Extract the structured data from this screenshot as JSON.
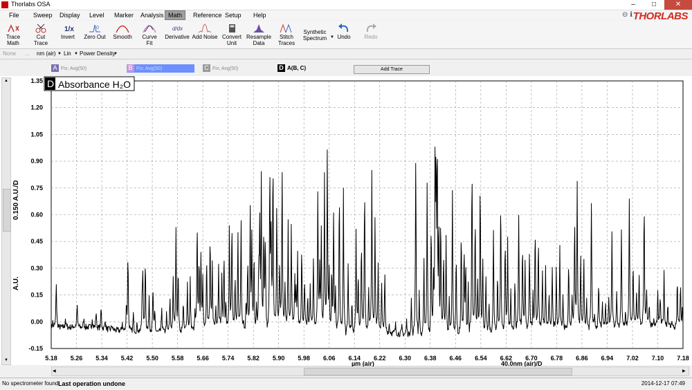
{
  "window": {
    "title": "Thorlabs OSA"
  },
  "menu": {
    "items": [
      "File",
      "Sweep",
      "Display",
      "Level",
      "Marker",
      "Analysis",
      "Math",
      "Reference",
      "Setup",
      "Help"
    ],
    "active": "Math"
  },
  "logo": "THORLABS",
  "toolbar": {
    "trace_math": "Trace Math",
    "cut_trace": "Cut Trace",
    "invert": "Invert",
    "zero_out": "Zero Out",
    "smooth": "Smooth",
    "curve_fit": "Curve Fit",
    "derivative": "Derivative",
    "add_noise": "Add Noise",
    "convert_unit": "Convert Unit",
    "resample_data": "Resample Data",
    "stitch_traces": "Stitch Traces",
    "synthetic_spectrum": "Synthetic Spectrum",
    "undo": "Undo",
    "redo": "Redo"
  },
  "unitbar": {
    "none": "None",
    "ellipsis": "...",
    "unit": "nm (air)",
    "scale": "Lin",
    "mode": "Power Density"
  },
  "traces": {
    "a": {
      "letter": "A",
      "label": "Fix; Avg(50)",
      "color": "#7b6fb4"
    },
    "b": {
      "letter": "B",
      "label": "Fix; Avg(50)",
      "color": "#c897d6"
    },
    "c": {
      "letter": "C",
      "label": "Fix; Avg(50)",
      "color": "#999999"
    },
    "d": {
      "letter": "D",
      "label": "A(B, C)",
      "color": "#000000"
    },
    "add_button": "Add Trace"
  },
  "plot": {
    "badge_letter": "D",
    "badge_title": "Absorbance H₂O",
    "y_axis_label": "A.U.",
    "y_scale_label": "0.150 A.U./D",
    "x_axis_label": "µm (air)",
    "x_scale_label": "40.0nm (air)/D"
  },
  "chart_data": {
    "type": "line",
    "title": "Absorbance H₂O",
    "xlabel": "µm (air)",
    "ylabel": "A.U.",
    "xlim": [
      5.18,
      7.18
    ],
    "ylim": [
      -0.15,
      1.35
    ],
    "x_ticks": [
      "5.18",
      "5.26",
      "5.34",
      "5.42",
      "5.50",
      "5.58",
      "5.66",
      "5.74",
      "5.82",
      "5.90",
      "5.98",
      "6.06",
      "6.14",
      "6.22",
      "6.30",
      "6.38",
      "6.46",
      "6.54",
      "6.62",
      "6.70",
      "6.78",
      "6.86",
      "6.94",
      "7.02",
      "7.10",
      "7.18"
    ],
    "y_ticks": [
      "1.35",
      "1.20",
      "1.05",
      "0.90",
      "0.75",
      "0.60",
      "0.45",
      "0.30",
      "0.15",
      "0.00",
      "-0.15"
    ],
    "grid": true,
    "baseline": [
      [
        5.18,
        -0.03
      ],
      [
        5.3,
        -0.03
      ],
      [
        5.4,
        -0.05
      ],
      [
        5.5,
        -0.06
      ],
      [
        5.6,
        -0.05
      ],
      [
        5.7,
        -0.03
      ],
      [
        5.8,
        -0.05
      ],
      [
        5.9,
        -0.03
      ],
      [
        6.0,
        -0.03
      ],
      [
        6.1,
        -0.06
      ],
      [
        6.2,
        -0.05
      ],
      [
        6.3,
        -0.07
      ],
      [
        6.4,
        -0.08
      ],
      [
        6.5,
        -0.07
      ],
      [
        6.6,
        -0.06
      ],
      [
        6.7,
        -0.04
      ],
      [
        6.8,
        -0.04
      ],
      [
        6.9,
        -0.03
      ],
      [
        7.0,
        -0.02
      ],
      [
        7.1,
        -0.02
      ],
      [
        7.18,
        -0.04
      ]
    ],
    "peaks": [
      [
        5.185,
        0.03
      ],
      [
        5.196,
        0.26
      ],
      [
        5.225,
        0.05
      ],
      [
        5.25,
        0.01
      ],
      [
        5.262,
        0.13
      ],
      [
        5.283,
        0.05
      ],
      [
        5.31,
        0.06
      ],
      [
        5.322,
        0.1
      ],
      [
        5.338,
        0.12
      ],
      [
        5.351,
        0.06
      ],
      [
        5.372,
        0.03
      ],
      [
        5.405,
        0.05
      ],
      [
        5.418,
        0.15
      ],
      [
        5.423,
        0.45
      ],
      [
        5.44,
        0.1
      ],
      [
        5.452,
        0.05
      ],
      [
        5.468,
        0.2
      ],
      [
        5.47,
        0.28
      ],
      [
        5.478,
        0.43
      ],
      [
        5.49,
        0.21
      ],
      [
        5.502,
        0.26
      ],
      [
        5.508,
        0.12
      ],
      [
        5.53,
        0.14
      ],
      [
        5.545,
        0.1
      ],
      [
        5.556,
        0.2
      ],
      [
        5.566,
        0.31
      ],
      [
        5.575,
        0.59
      ],
      [
        5.582,
        0.36
      ],
      [
        5.598,
        0.17
      ],
      [
        5.611,
        0.28
      ],
      [
        5.62,
        0.29
      ],
      [
        5.635,
        0.09
      ],
      [
        5.642,
        0.6
      ],
      [
        5.648,
        0.38
      ],
      [
        5.654,
        0.43
      ],
      [
        5.66,
        0.3
      ],
      [
        5.672,
        0.43
      ],
      [
        5.683,
        0.53
      ],
      [
        5.69,
        0.35
      ],
      [
        5.701,
        0.14
      ],
      [
        5.71,
        0.37
      ],
      [
        5.72,
        0.3
      ],
      [
        5.727,
        0.43
      ],
      [
        5.733,
        0.14
      ],
      [
        5.744,
        0.59
      ],
      [
        5.752,
        0.62
      ],
      [
        5.762,
        0.31
      ],
      [
        5.771,
        0.58
      ],
      [
        5.781,
        0.63
      ],
      [
        5.789,
        0.05
      ],
      [
        5.797,
        0.16
      ],
      [
        5.802,
        0.4
      ],
      [
        5.81,
        0.67
      ],
      [
        5.815,
        0.52
      ],
      [
        5.822,
        0.45
      ],
      [
        5.83,
        0.16
      ],
      [
        5.837,
        0.37
      ],
      [
        5.84,
        0.57
      ],
      [
        5.845,
        0.85
      ],
      [
        5.853,
        0.57
      ],
      [
        5.858,
        0.51
      ],
      [
        5.872,
        0.94
      ],
      [
        5.876,
        0.52
      ],
      [
        5.882,
        0.97
      ],
      [
        5.894,
        0.68
      ],
      [
        5.903,
        0.41
      ],
      [
        5.911,
        0.89
      ],
      [
        5.92,
        0.27
      ],
      [
        5.93,
        0.61
      ],
      [
        5.94,
        0.58
      ],
      [
        5.951,
        0.29
      ],
      [
        5.955,
        0.21
      ],
      [
        5.96,
        0.41
      ],
      [
        5.973,
        0.46
      ],
      [
        5.982,
        0.29
      ],
      [
        5.992,
        0.18
      ],
      [
        6.0,
        0.24
      ],
      [
        6.01,
        0.4
      ],
      [
        6.024,
        0.8
      ],
      [
        6.03,
        0.34
      ],
      [
        6.035,
        0.56
      ],
      [
        6.045,
        0.87
      ],
      [
        6.054,
        1.03
      ],
      [
        6.06,
        0.34
      ],
      [
        6.068,
        0.35
      ],
      [
        6.074,
        0.66
      ],
      [
        6.08,
        0.23
      ],
      [
        6.092,
        0.81
      ],
      [
        6.105,
        0.81
      ],
      [
        6.12,
        0.37
      ],
      [
        6.132,
        0.18
      ],
      [
        6.145,
        0.57
      ],
      [
        6.152,
        0.34
      ],
      [
        6.162,
        0.53
      ],
      [
        6.172,
        0.85
      ],
      [
        6.185,
        0.26
      ],
      [
        6.195,
        0.91
      ],
      [
        6.205,
        0.62
      ],
      [
        6.215,
        0.37
      ],
      [
        6.226,
        0.28
      ],
      [
        6.236,
        0.33
      ],
      [
        6.25,
        0.05
      ],
      [
        6.27,
        0.05
      ],
      [
        6.29,
        0.04
      ],
      [
        6.305,
        0.08
      ],
      [
        6.32,
        0.2
      ],
      [
        6.334,
        1.02
      ],
      [
        6.345,
        0.25
      ],
      [
        6.36,
        0.42
      ],
      [
        6.37,
        0.86
      ],
      [
        6.383,
        0.65
      ],
      [
        6.39,
        0.32
      ],
      [
        6.395,
        0.87
      ],
      [
        6.398,
        0.92
      ],
      [
        6.402,
        1.06
      ],
      [
        6.407,
        0.62
      ],
      [
        6.413,
        0.68
      ],
      [
        6.422,
        0.49
      ],
      [
        6.43,
        0.56
      ],
      [
        6.44,
        0.23
      ],
      [
        6.45,
        0.83
      ],
      [
        6.462,
        0.48
      ],
      [
        6.478,
        0.61
      ],
      [
        6.487,
        0.49
      ],
      [
        6.492,
        0.4
      ],
      [
        6.5,
        0.3
      ],
      [
        6.512,
        0.98
      ],
      [
        6.522,
        0.68
      ],
      [
        6.53,
        0.32
      ],
      [
        6.538,
        0.9
      ],
      [
        6.546,
        0.43
      ],
      [
        6.556,
        0.33
      ],
      [
        6.566,
        0.18
      ],
      [
        6.58,
        0.58
      ],
      [
        6.593,
        0.36
      ],
      [
        6.603,
        0.78
      ],
      [
        6.617,
        0.55
      ],
      [
        6.625,
        0.53
      ],
      [
        6.635,
        0.24
      ],
      [
        6.648,
        0.3
      ],
      [
        6.66,
        0.65
      ],
      [
        6.672,
        0.51
      ],
      [
        6.68,
        0.38
      ],
      [
        6.694,
        0.45
      ],
      [
        6.705,
        0.2
      ],
      [
        6.712,
        0.6
      ],
      [
        6.722,
        0.53
      ],
      [
        6.735,
        0.34
      ],
      [
        6.745,
        0.35
      ],
      [
        6.756,
        0.21
      ],
      [
        6.766,
        0.37
      ],
      [
        6.779,
        0.35
      ],
      [
        6.79,
        0.47
      ],
      [
        6.8,
        0.2
      ],
      [
        6.818,
        0.37
      ],
      [
        6.829,
        0.2
      ],
      [
        6.837,
        0.65
      ],
      [
        6.845,
        0.83
      ],
      [
        6.856,
        0.41
      ],
      [
        6.866,
        0.41
      ],
      [
        6.875,
        0.15
      ],
      [
        6.89,
        0.71
      ],
      [
        6.9,
        0.06
      ],
      [
        6.913,
        0.24
      ],
      [
        6.925,
        0.13
      ],
      [
        6.935,
        0.14
      ],
      [
        6.945,
        0.18
      ],
      [
        6.955,
        0.54
      ],
      [
        6.97,
        0.21
      ],
      [
        6.985,
        0.53
      ],
      [
        6.998,
        0.08
      ],
      [
        7.01,
        0.7
      ],
      [
        7.022,
        0.34
      ],
      [
        7.033,
        0.2
      ],
      [
        7.041,
        0.31
      ],
      [
        7.057,
        0.73
      ],
      [
        7.065,
        0.21
      ],
      [
        7.073,
        0.13
      ],
      [
        7.087,
        0.03
      ],
      [
        7.1,
        0.18
      ],
      [
        7.108,
        0.18
      ],
      [
        7.12,
        0.3
      ],
      [
        7.132,
        0.14
      ],
      [
        7.145,
        0.05
      ],
      [
        7.162,
        0.28
      ],
      [
        7.172,
        0.26
      ],
      [
        7.178,
        0.12
      ]
    ]
  },
  "status": {
    "device": "No spectrometer found",
    "operation": "Last operation undone",
    "timestamp": "2014-12-17 07:49"
  }
}
